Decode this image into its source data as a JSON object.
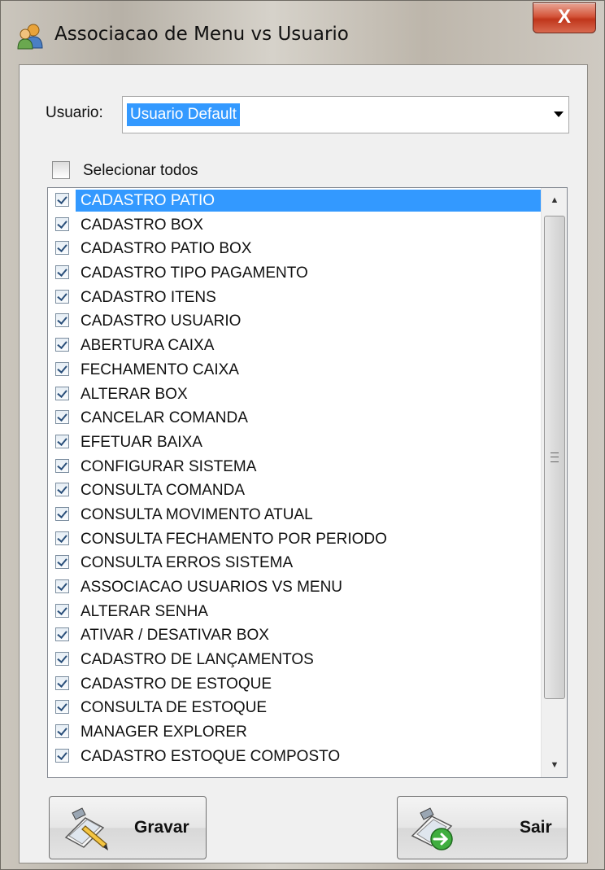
{
  "window": {
    "title": "Associacao de Menu vs Usuario",
    "close_label": "X"
  },
  "usuario": {
    "label": "Usuario:",
    "selected_value": "Usuario Default"
  },
  "select_all": {
    "label": "Selecionar todos",
    "checked": false
  },
  "menu_list": {
    "items": [
      {
        "label": "CADASTRO PATIO",
        "checked": true,
        "selected": true
      },
      {
        "label": "CADASTRO BOX",
        "checked": true
      },
      {
        "label": "CADASTRO PATIO BOX",
        "checked": true
      },
      {
        "label": "CADASTRO TIPO PAGAMENTO",
        "checked": true
      },
      {
        "label": "CADASTRO ITENS",
        "checked": true
      },
      {
        "label": "CADASTRO USUARIO",
        "checked": true
      },
      {
        "label": "ABERTURA CAIXA",
        "checked": true
      },
      {
        "label": "FECHAMENTO CAIXA",
        "checked": true
      },
      {
        "label": "ALTERAR BOX",
        "checked": true
      },
      {
        "label": "CANCELAR COMANDA",
        "checked": true
      },
      {
        "label": "EFETUAR BAIXA",
        "checked": true
      },
      {
        "label": "CONFIGURAR SISTEMA",
        "checked": true
      },
      {
        "label": "CONSULTA COMANDA",
        "checked": true
      },
      {
        "label": "CONSULTA MOVIMENTO ATUAL",
        "checked": true
      },
      {
        "label": "CONSULTA FECHAMENTO POR PERIODO",
        "checked": true
      },
      {
        "label": "CONSULTA ERROS SISTEMA",
        "checked": true
      },
      {
        "label": "ASSOCIACAO USUARIOS VS MENU",
        "checked": true
      },
      {
        "label": "ALTERAR SENHA",
        "checked": true
      },
      {
        "label": "ATIVAR / DESATIVAR BOX",
        "checked": true
      },
      {
        "label": "CADASTRO DE LANÇAMENTOS",
        "checked": true
      },
      {
        "label": "CADASTRO DE ESTOQUE",
        "checked": true
      },
      {
        "label": "CONSULTA DE ESTOQUE",
        "checked": true
      },
      {
        "label": "MANAGER EXPLORER",
        "checked": true
      },
      {
        "label": "CADASTRO ESTOQUE COMPOSTO",
        "checked": true
      }
    ]
  },
  "buttons": {
    "save_label": "Gravar",
    "exit_label": "Sair"
  },
  "colors": {
    "selection": "#3399ff",
    "close_button": "#c8452a"
  }
}
